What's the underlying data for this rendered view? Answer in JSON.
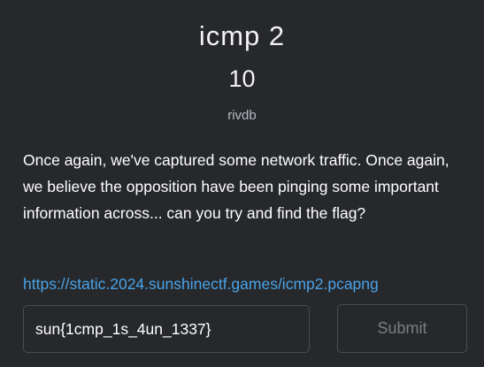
{
  "challenge": {
    "title": "icmp 2",
    "points": "10",
    "author": "rivdb",
    "description": "Once again, we've captured some network traffic. Once again, we believe the opposition have been pinging some important information across... can you try and find the flag?",
    "link": "https://static.2024.sunshinectf.games/icmp2.pcapng"
  },
  "form": {
    "flag_value": "sun{1cmp_1s_4un_1337}",
    "submit_label": "Submit"
  },
  "colors": {
    "background": "#26282b",
    "link": "#4aa3e8",
    "border": "#4a4d52",
    "muted_text": "#7a7e84"
  }
}
